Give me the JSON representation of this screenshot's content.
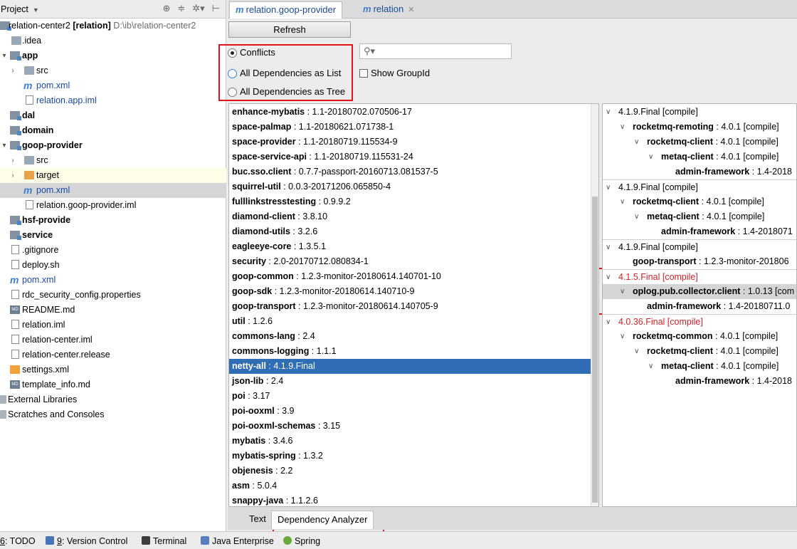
{
  "project_panel": {
    "title": "Project",
    "tree": [
      {
        "label": "relation-center2",
        "bold_suffix": " [relation]",
        "path": "D:\\ib\\relation-center2"
      },
      {
        "label": ".idea"
      },
      {
        "label": "app"
      },
      {
        "label": "src"
      },
      {
        "label": "pom.xml"
      },
      {
        "label": "relation.app.iml"
      },
      {
        "label": "dal"
      },
      {
        "label": "domain"
      },
      {
        "label": "goop-provider"
      },
      {
        "label": "src"
      },
      {
        "label": "target"
      },
      {
        "label": "pom.xml"
      },
      {
        "label": "relation.goop-provider.iml"
      },
      {
        "label": "hsf-provide"
      },
      {
        "label": "service"
      },
      {
        "label": ".gitignore"
      },
      {
        "label": "deploy.sh"
      },
      {
        "label": "pom.xml"
      },
      {
        "label": "rdc_security_config.properties"
      },
      {
        "label": "README.md"
      },
      {
        "label": "relation.iml"
      },
      {
        "label": "relation-center.iml"
      },
      {
        "label": "relation-center.release"
      },
      {
        "label": "settings.xml"
      },
      {
        "label": "template_info.md"
      },
      {
        "label": "External Libraries"
      },
      {
        "label": "Scratches and Consoles"
      }
    ]
  },
  "tabs": [
    {
      "icon": "m",
      "label": "relation.goop-provider"
    },
    {
      "icon": "m",
      "label": "relation"
    }
  ],
  "toolbar": {
    "refresh_label": "Refresh",
    "radio_conflicts": "Conflicts",
    "radio_list": "All Dependencies as List",
    "radio_tree": "All Dependencies as Tree",
    "search_placeholder": "",
    "show_groupid": "Show GroupId"
  },
  "dependencies": [
    {
      "name": "enhance-mybatis",
      "version": " : 1.1-20180702.070506-17"
    },
    {
      "name": "space-palmap",
      "version": " : 1.1-20180621.071738-1"
    },
    {
      "name": "space-provider",
      "version": " : 1.1-20180719.115534-9"
    },
    {
      "name": "space-service-api",
      "version": " : 1.1-20180719.115531-24"
    },
    {
      "name": "buc.sso.client",
      "version": " : 0.7.7-passport-20160713.081537-5"
    },
    {
      "name": "squirrel-util",
      "version": " : 0.0.3-20171206.065850-4"
    },
    {
      "name": "fulllinkstresstesting",
      "version": " : 0.9.9.2"
    },
    {
      "name": "diamond-client",
      "version": " : 3.8.10"
    },
    {
      "name": "diamond-utils",
      "version": " : 3.2.6"
    },
    {
      "name": "eagleeye-core",
      "version": " : 1.3.5.1"
    },
    {
      "name": "security",
      "version": " : 2.0-20170712.080834-1"
    },
    {
      "name": "goop-common",
      "version": " : 1.2.3-monitor-20180614.140701-10"
    },
    {
      "name": "goop-sdk",
      "version": " : 1.2.3-monitor-20180614.140710-9"
    },
    {
      "name": "goop-transport",
      "version": " : 1.2.3-monitor-20180614.140705-9"
    },
    {
      "name": "util",
      "version": " : 1.2.6"
    },
    {
      "name": "commons-lang",
      "version": " : 2.4"
    },
    {
      "name": "commons-logging",
      "version": " : 1.1.1"
    },
    {
      "name": "netty-all",
      "version": " : 4.1.9.Final"
    },
    {
      "name": "json-lib",
      "version": " : 2.4"
    },
    {
      "name": "poi",
      "version": " : 3.17"
    },
    {
      "name": "poi-ooxml",
      "version": " : 3.9"
    },
    {
      "name": "poi-ooxml-schemas",
      "version": " : 3.15"
    },
    {
      "name": "mybatis",
      "version": " : 3.4.6"
    },
    {
      "name": "mybatis-spring",
      "version": " : 1.3.2"
    },
    {
      "name": "objenesis",
      "version": " : 2.2"
    },
    {
      "name": "asm",
      "version": " : 5.0.4"
    },
    {
      "name": "snappy-java",
      "version": " : 1.1.2.6"
    }
  ],
  "usages": [
    {
      "name": "",
      "text": "4.1.9.Final [compile]"
    },
    {
      "name": "rocketmq-remoting",
      "text": " : 4.0.1 [compile]"
    },
    {
      "name": "rocketmq-client",
      "text": " : 4.0.1 [compile]"
    },
    {
      "name": "metaq-client",
      "text": " : 4.0.1 [compile]"
    },
    {
      "name": "admin-framework",
      "text": " : 1.4-2018"
    },
    {
      "name": "",
      "text": "4.1.9.Final [compile]"
    },
    {
      "name": "rocketmq-client",
      "text": " : 4.0.1 [compile]"
    },
    {
      "name": "metaq-client",
      "text": " : 4.0.1 [compile]"
    },
    {
      "name": "admin-framework",
      "text": " : 1.4-2018071"
    },
    {
      "name": "",
      "text": "4.1.9.Final [compile]"
    },
    {
      "name": "goop-transport",
      "text": " : 1.2.3-monitor-201806"
    },
    {
      "name": "",
      "text": "4.1.5.Final [compile]"
    },
    {
      "name": "oplog.pub.collector.client",
      "text": " : 1.0.13 [com"
    },
    {
      "name": "admin-framework",
      "text": " : 1.4-20180711.0"
    },
    {
      "name": "",
      "text": "4.0.36.Final [compile]"
    },
    {
      "name": "rocketmq-common",
      "text": " : 4.0.1 [compile]"
    },
    {
      "name": "rocketmq-client",
      "text": " : 4.0.1 [compile]"
    },
    {
      "name": "metaq-client",
      "text": " : 4.0.1 [compile]"
    },
    {
      "name": "admin-framework",
      "text": " : 1.4-2018"
    }
  ],
  "bottom_tabs": [
    "Text",
    "Dependency Analyzer"
  ],
  "status_bar": [
    {
      "num": "6",
      "label": ": TODO"
    },
    {
      "num": "9",
      "label": ": Version Control"
    },
    {
      "num": "",
      "label": "Terminal"
    },
    {
      "num": "",
      "label": "Java Enterprise"
    },
    {
      "num": "",
      "label": "Spring"
    }
  ],
  "colors": {
    "selection": "#2f6db5",
    "conflict_red": "#d3212a",
    "annotation_red": "#e0141b"
  }
}
